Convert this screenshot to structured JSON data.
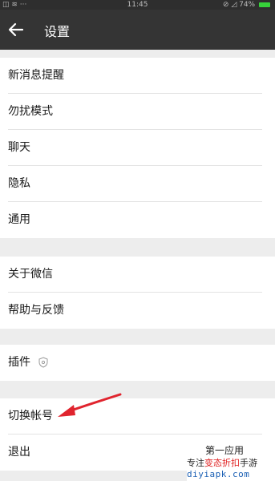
{
  "status_bar": {
    "left_icons": "◫ ≋ ···",
    "time": "11:45",
    "right_text": "⊘ ◿ 74%"
  },
  "header": {
    "title": "设置"
  },
  "groups": [
    {
      "items": [
        "新消息提醒",
        "勿扰模式",
        "聊天",
        "隐私",
        "通用"
      ]
    },
    {
      "items": [
        "关于微信",
        "帮助与反馈"
      ]
    },
    {
      "items": [
        "插件"
      ]
    },
    {
      "items": [
        "切换帐号",
        "退出"
      ]
    }
  ],
  "watermark": {
    "line1": "第一应用",
    "line2_a": "专注",
    "line2_b": "变态折扣",
    "line2_c": "手游",
    "line3": "diyiapk.com"
  },
  "colors": {
    "topbar": "#343434",
    "background": "#ededed",
    "arrow": "#e0242e",
    "battery": "#36d13a"
  },
  "icons": [
    "back-arrow-icon",
    "plugin-shield-icon",
    "wifi-icon",
    "battery-icon"
  ]
}
